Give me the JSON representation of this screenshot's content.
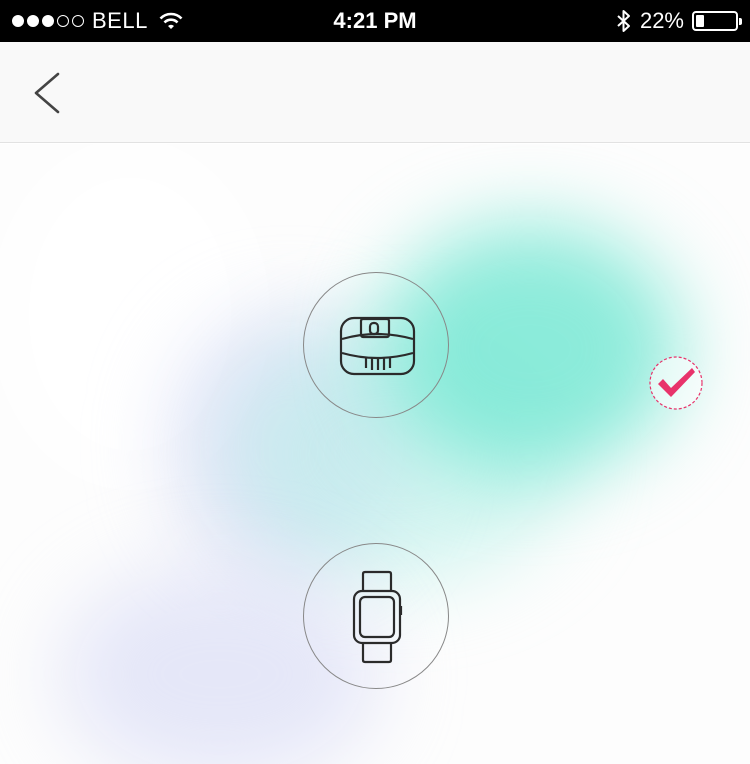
{
  "status_bar": {
    "carrier": "BELL",
    "signal_bars_filled": 3,
    "signal_bars_total": 5,
    "time": "4:21 PM",
    "battery_percent": "22%",
    "battery_level": 0.22
  },
  "nav": {
    "title": "",
    "back_icon": "chevron-left-icon"
  },
  "content": {
    "section_title": "",
    "devices": [
      {
        "name": "Band",
        "label": "",
        "icon": "fitness-band-icon",
        "selected": true
      },
      {
        "name": "Watch",
        "label": "",
        "icon": "smartwatch-icon",
        "selected": false
      }
    ],
    "selected_icon": "checkmark-icon"
  },
  "colors": {
    "status_bar_bg": "#000000",
    "nav_bg": "#f9f9f9",
    "mint_glow": "#78e8d4",
    "lavender_glow": "#d2d7f5",
    "check_accent": "#e8336b",
    "circle_border": "#888888"
  }
}
